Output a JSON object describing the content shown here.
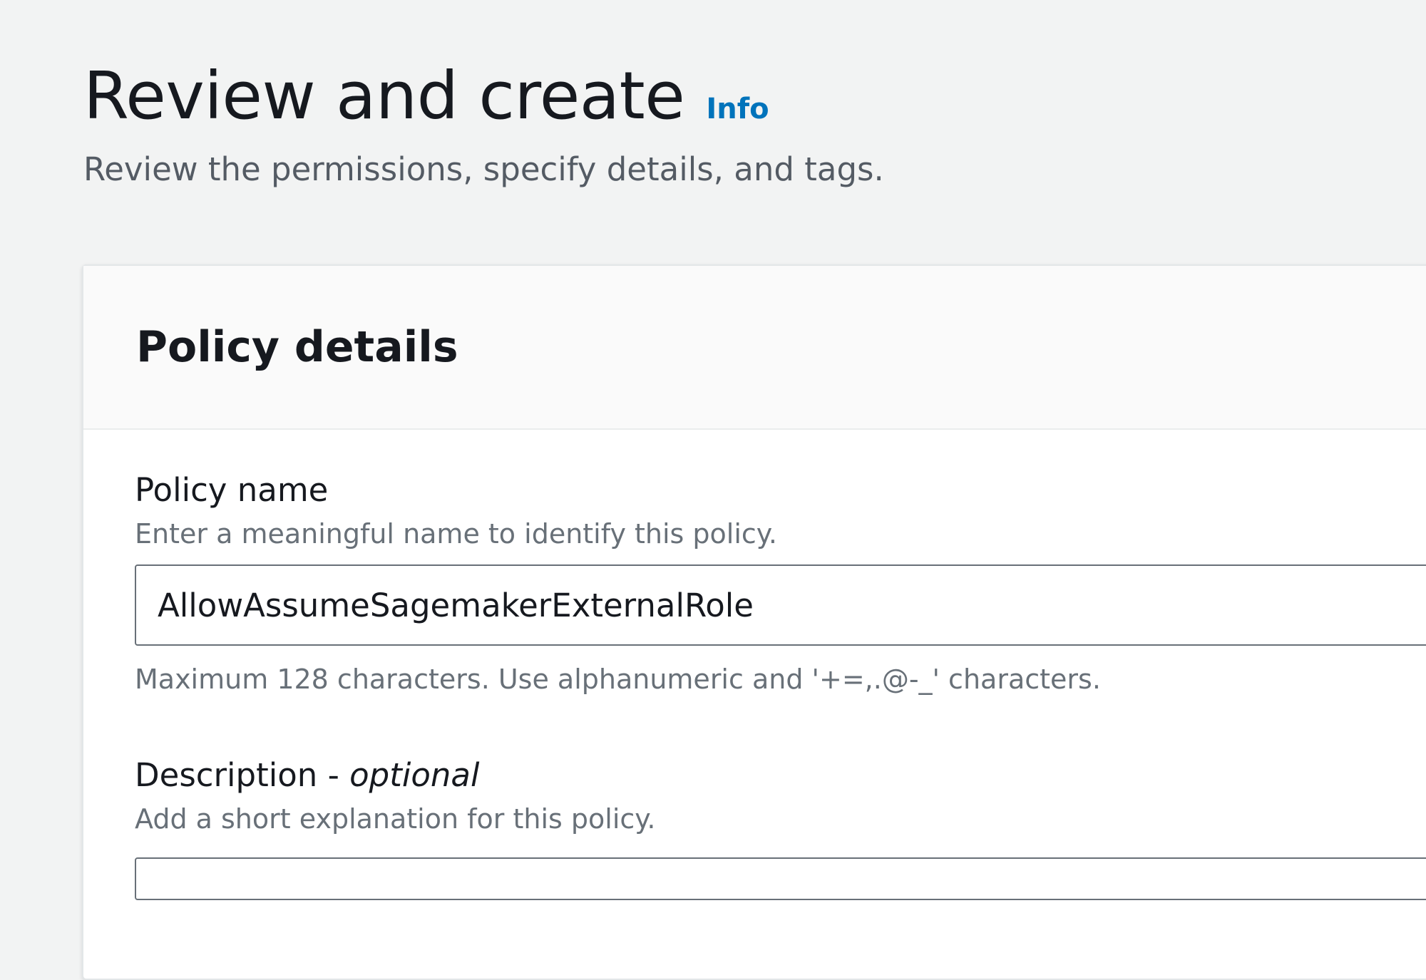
{
  "header": {
    "title": "Review and create",
    "info_label": "Info",
    "subtitle": "Review the permissions, specify details, and tags."
  },
  "policy_details": {
    "title": "Policy details",
    "policy_name": {
      "label": "Policy name",
      "description": "Enter a meaningful name to identify this policy.",
      "value": "AllowAssumeSagemakerExternalRole",
      "constraint": "Maximum 128 characters. Use alphanumeric and '+=,.@-_' characters."
    },
    "description_field": {
      "label": "Description - ",
      "label_optional": "optional",
      "description": "Add a short explanation for this policy.",
      "value": ""
    }
  },
  "colors": {
    "background": "#f2f3f3",
    "link": "#0073bb",
    "text_primary": "#16191f",
    "text_secondary": "#687078"
  }
}
